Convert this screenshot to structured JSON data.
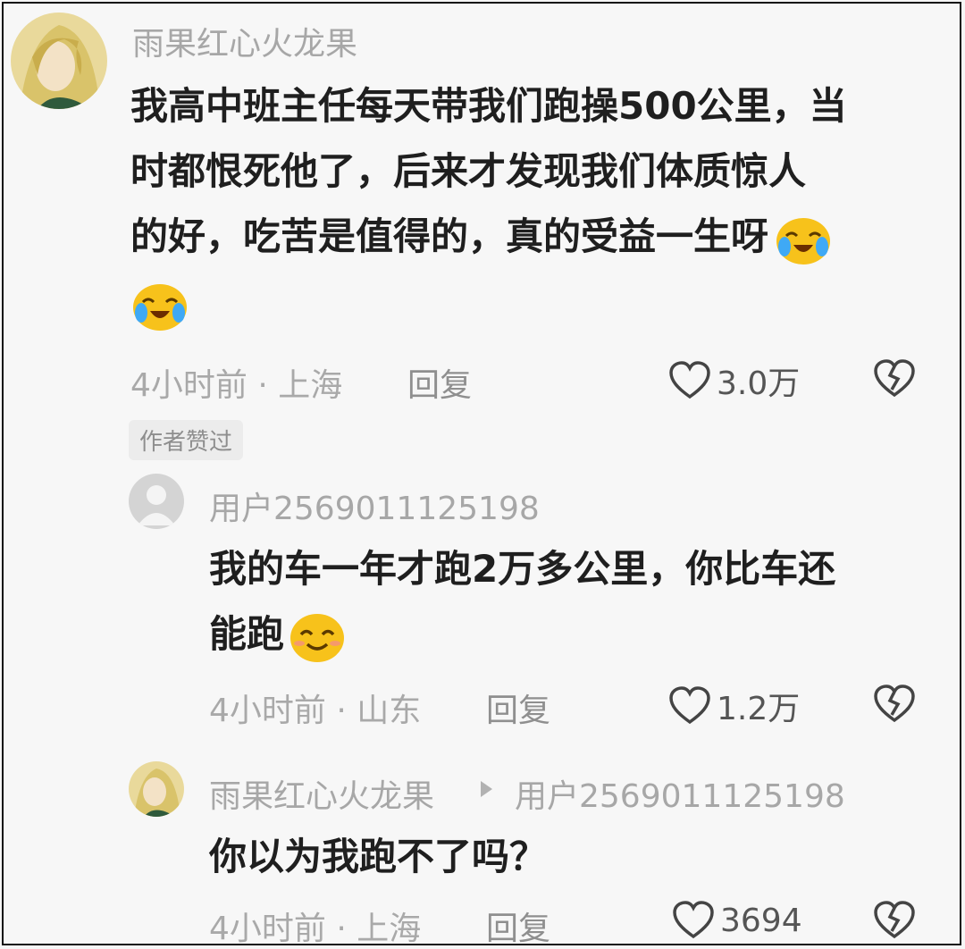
{
  "comments": [
    {
      "username": "雨果红心火龙果",
      "text_lines": [
        "我高中班主任每天带我们跑操500公里，当",
        "时都恨死他了，后来才发现我们体质惊人",
        "的好，吃苦是值得的，真的受益一生呀"
      ],
      "time_location": "4小时前 · 上海",
      "reply_label": "回复",
      "likes": "3.0万",
      "badge": "作者赞过",
      "emojis": [
        "crying-laughing-emoji",
        "crying-laughing-emoji"
      ]
    },
    {
      "username": "用户2569011125198",
      "text_lines": [
        "我的车一年才跑2万多公里，你比车还",
        "能跑"
      ],
      "time_location": "4小时前 · 山东",
      "reply_label": "回复",
      "likes": "1.2万",
      "emojis": [
        "smiling-emoji"
      ]
    },
    {
      "username": "雨果红心火龙果",
      "reply_to": "用户2569011125198",
      "text_lines": [
        "你以为我跑不了吗？"
      ],
      "time_location": "4小时前 · 上海",
      "reply_label": "回复",
      "likes": "3694"
    }
  ],
  "colors": {
    "username": "#a7a7a7",
    "body": "#1f1f1f",
    "meta": "#a9a9a9",
    "emoji_yellow": "#f7c21b"
  }
}
